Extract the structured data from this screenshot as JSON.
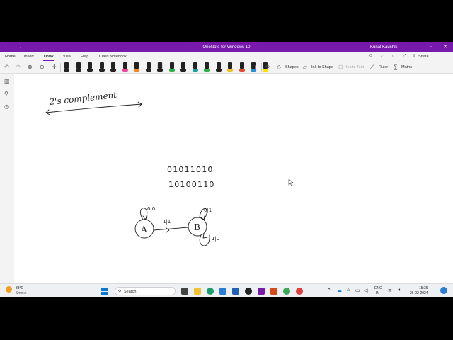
{
  "window": {
    "title": "OneNote for Windows 10",
    "user": "Kunal Kaushik"
  },
  "tabs": [
    {
      "label": "Home"
    },
    {
      "label": "Insert"
    },
    {
      "label": "Draw",
      "active": true
    },
    {
      "label": "View"
    },
    {
      "label": "Help"
    },
    {
      "label": "Class Notebook"
    }
  ],
  "share_label": "Share",
  "ribbon": {
    "shapes_label": "Shapes",
    "ink_to_shape_label": "Ink to Shape",
    "ink_to_text_label": "Ink to Text",
    "ruler_label": "Ruler",
    "maths_label": "Maths",
    "pens": [
      {
        "tip": "#222222"
      },
      {
        "tip": "#222222"
      },
      {
        "tip": "#222222"
      },
      {
        "tip": "#222222"
      },
      {
        "tip": "#222222"
      },
      {
        "tip": "#e84aa0"
      },
      {
        "tip": "#f08a24"
      },
      {
        "tip": "#222222"
      },
      {
        "tip": "#222222",
        "selected": true
      },
      {
        "tip": "#2db34a"
      },
      {
        "tip": "#222222"
      },
      {
        "tip": "#1aa3a3"
      },
      {
        "tip": "#2db34a"
      },
      {
        "tip": "#222222"
      },
      {
        "tip": "#f0c020"
      },
      {
        "tip": "#e84a30"
      },
      {
        "tip": "#2a8fd8"
      },
      {
        "tip": "#f5e300"
      }
    ]
  },
  "ink": {
    "heading": "2's complement",
    "binary_line_1": "01011010",
    "binary_line_2": "10100110",
    "state_a": "A",
    "state_b": "B",
    "loop_a_label": "0|0",
    "loop_b_top_label": "0|1",
    "transition_label": "1|1",
    "loop_b_bottom_label": "1|0"
  },
  "taskbar": {
    "weather_temp": "33°C",
    "weather_desc": "Smoke",
    "search_placeholder": "Search",
    "lang_1": "ENG",
    "lang_2": "IN",
    "time": "15:36",
    "date": "26-02-2024"
  }
}
